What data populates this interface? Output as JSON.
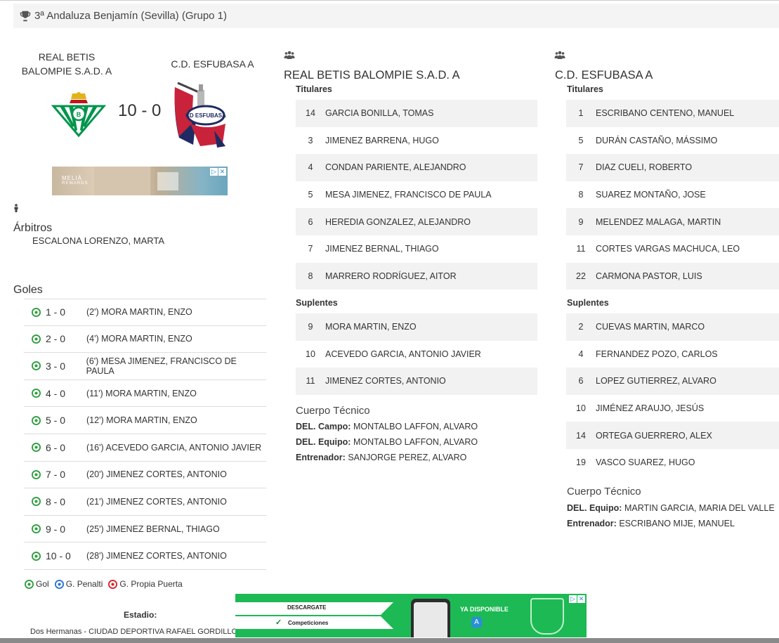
{
  "header": {
    "title": "3ª Andaluza Benjamín (Sevilla) (Grupo 1)"
  },
  "match": {
    "home_team": "REAL BETIS BALOMPIE S.A.D. A",
    "home_line1": "REAL BETIS",
    "home_line2": "BALOMPIE S.A.D. A",
    "away_team": "C.D. ESFUBASA A",
    "score": "10 - 0"
  },
  "ads": {
    "small_brand": "MELIÁ",
    "small_brand2": "REWARDS",
    "big_t1": "DESCARGATE",
    "big_t2": "Competiciones",
    "big_t3": "YA DISPONIBLE"
  },
  "referees": {
    "title": "Árbitros",
    "name": "ESCALONA LORENZO, MARTA"
  },
  "goals": {
    "title": "Goles",
    "items": [
      {
        "score": "1 - 0",
        "text": "(2') MORA MARTIN, ENZO"
      },
      {
        "score": "2 - 0",
        "text": "(4') MORA MARTIN, ENZO"
      },
      {
        "score": "3 - 0",
        "text": "(6') MESA JIMENEZ, FRANCISCO DE PAULA"
      },
      {
        "score": "4 - 0",
        "text": "(11') MORA MARTIN, ENZO"
      },
      {
        "score": "5 - 0",
        "text": "(12') MORA MARTIN, ENZO"
      },
      {
        "score": "6 - 0",
        "text": "(16') ACEVEDO GARCIA, ANTONIO JAVIER"
      },
      {
        "score": "7 - 0",
        "text": "(20') JIMENEZ CORTES, ANTONIO"
      },
      {
        "score": "8 - 0",
        "text": "(21') JIMENEZ CORTES, ANTONIO"
      },
      {
        "score": "9 - 0",
        "text": "(25') JIMENEZ BERNAL, THIAGO"
      },
      {
        "score": "10 - 0",
        "text": "(28') JIMENEZ CORTES, ANTONIO"
      }
    ],
    "legend": {
      "gol": "Gol",
      "penalti": "G. Penalti",
      "propia": "G. Propia Puerta"
    }
  },
  "stadium": {
    "label": "Estadio:",
    "value": "Dos Hermanas - CIUDAD DEPORTIVA RAFAEL GORDILLO"
  },
  "home": {
    "title": "REAL BETIS BALOMPIE S.A.D. A",
    "titulares_label": "Titulares",
    "titulares": [
      {
        "num": "14",
        "name": "GARCIA BONILLA, TOMAS"
      },
      {
        "num": "3",
        "name": "JIMENEZ BARRENA, HUGO"
      },
      {
        "num": "4",
        "name": "CONDAN PARIENTE, ALEJANDRO"
      },
      {
        "num": "5",
        "name": "MESA JIMENEZ, FRANCISCO DE PAULA"
      },
      {
        "num": "6",
        "name": "HEREDIA GONZALEZ, ALEJANDRO"
      },
      {
        "num": "7",
        "name": "JIMENEZ BERNAL, THIAGO"
      },
      {
        "num": "8",
        "name": "MARRERO RODRÍGUEZ, AITOR"
      }
    ],
    "suplentes_label": "Suplentes",
    "suplentes": [
      {
        "num": "9",
        "name": "MORA MARTIN, ENZO"
      },
      {
        "num": "10",
        "name": "ACEVEDO GARCIA, ANTONIO JAVIER"
      },
      {
        "num": "11",
        "name": "JIMENEZ CORTES, ANTONIO"
      }
    ],
    "staff_title": "Cuerpo Técnico",
    "staff": [
      {
        "role": "DEL. Campo:",
        "name": "MONTALBO LAFFON, ALVARO"
      },
      {
        "role": "DEL. Equipo:",
        "name": "MONTALBO LAFFON, ALVARO"
      },
      {
        "role": "Entrenador:",
        "name": "SANJORGE PEREZ, ALVARO"
      }
    ]
  },
  "away": {
    "title": "C.D. ESFUBASA A",
    "titulares_label": "Titulares",
    "titulares": [
      {
        "num": "1",
        "name": "ESCRIBANO CENTENO, MANUEL"
      },
      {
        "num": "5",
        "name": "DURÁN CASTAÑO, MÁSSIMO"
      },
      {
        "num": "7",
        "name": "DIAZ CUELI, ROBERTO"
      },
      {
        "num": "8",
        "name": "SUAREZ MONTAÑO, JOSE"
      },
      {
        "num": "9",
        "name": "MELENDEZ MALAGA, MARTIN"
      },
      {
        "num": "11",
        "name": "CORTES VARGAS MACHUCA, LEO"
      },
      {
        "num": "22",
        "name": "CARMONA PASTOR, LUIS"
      }
    ],
    "suplentes_label": "Suplentes",
    "suplentes": [
      {
        "num": "2",
        "name": "CUEVAS MARTIN, MARCO"
      },
      {
        "num": "4",
        "name": "FERNANDEZ POZO, CARLOS"
      },
      {
        "num": "6",
        "name": "LOPEZ GUTIERREZ, ALVARO"
      },
      {
        "num": "10",
        "name": "JIMÉNEZ ARAUJO, JESÚS"
      },
      {
        "num": "14",
        "name": "ORTEGA GUERRERO, ALEX"
      },
      {
        "num": "19",
        "name": "VASCO SUAREZ, HUGO"
      }
    ],
    "staff_title": "Cuerpo Técnico",
    "staff": [
      {
        "role": "DEL. Equipo:",
        "name": "MARTIN GARCIA, MARIA DEL VALLE"
      },
      {
        "role": "Entrenador:",
        "name": "ESCRIBANO MIJE, MANUEL"
      }
    ]
  }
}
